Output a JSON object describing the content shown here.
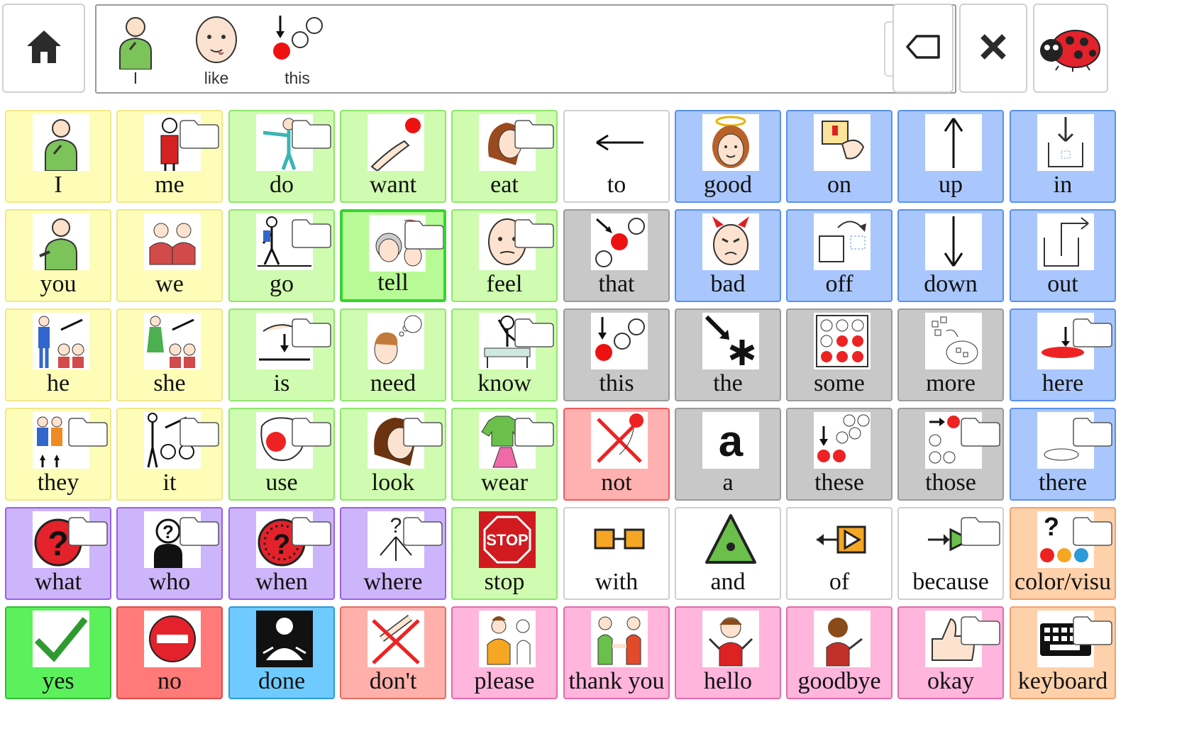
{
  "toolbar": {
    "home_label": "",
    "sentence_words": [
      {
        "label": "I",
        "icon": "person-pointing-self-icon"
      },
      {
        "label": "like",
        "icon": "face-licking-icon"
      },
      {
        "label": "this",
        "icon": "this-arrow-circles-icon"
      }
    ],
    "dropdown_icon": "chevron-down-icon",
    "backspace_icon": "backspace-icon",
    "clear_icon": "close-icon",
    "mascot_icon": "ladybug-icon"
  },
  "grid": {
    "cells": [
      {
        "label": "I",
        "color": "y",
        "icon": "person-pointing-self-icon",
        "folder": false
      },
      {
        "label": "me",
        "color": "y",
        "icon": "person-me-icon",
        "folder": true
      },
      {
        "label": "do",
        "color": "g",
        "icon": "person-doing-icon",
        "folder": true
      },
      {
        "label": "want",
        "color": "g",
        "icon": "hand-reaching-icon",
        "folder": false
      },
      {
        "label": "eat",
        "color": "g",
        "icon": "person-eating-icon",
        "folder": true
      },
      {
        "label": "to",
        "color": "w",
        "icon": "arrow-left-icon",
        "folder": false
      },
      {
        "label": "good",
        "color": "b",
        "icon": "angel-face-icon",
        "folder": false
      },
      {
        "label": "on",
        "color": "b",
        "icon": "switch-on-icon",
        "folder": false
      },
      {
        "label": "up",
        "color": "b",
        "icon": "arrow-up-icon",
        "folder": false
      },
      {
        "label": "in",
        "color": "b",
        "icon": "arrow-into-box-icon",
        "folder": false
      },
      {
        "label": "you",
        "color": "y",
        "icon": "person-pointing-you-icon",
        "folder": false
      },
      {
        "label": "we",
        "color": "y",
        "icon": "two-people-icon",
        "folder": false
      },
      {
        "label": "go",
        "color": "g",
        "icon": "people-walking-icon",
        "folder": true
      },
      {
        "label": "tell",
        "color": "sel",
        "icon": "people-talking-icon",
        "folder": true
      },
      {
        "label": "feel",
        "color": "g",
        "icon": "face-feeling-icon",
        "folder": true
      },
      {
        "label": "that",
        "color": "gr",
        "icon": "that-arrow-circles-icon",
        "folder": false
      },
      {
        "label": "bad",
        "color": "b",
        "icon": "devil-face-icon",
        "folder": false
      },
      {
        "label": "off",
        "color": "b",
        "icon": "box-off-icon",
        "folder": false
      },
      {
        "label": "down",
        "color": "b",
        "icon": "arrow-down-icon",
        "folder": false
      },
      {
        "label": "out",
        "color": "b",
        "icon": "arrow-out-box-icon",
        "folder": false
      },
      {
        "label": "he",
        "color": "y",
        "icon": "man-pointed-icon",
        "folder": false
      },
      {
        "label": "she",
        "color": "y",
        "icon": "woman-pointed-icon",
        "folder": false
      },
      {
        "label": "is",
        "color": "g",
        "icon": "hand-is-icon",
        "folder": true
      },
      {
        "label": "need",
        "color": "g",
        "icon": "person-thinking-icon",
        "folder": false
      },
      {
        "label": "know",
        "color": "g",
        "icon": "teacher-icon",
        "folder": true
      },
      {
        "label": "this",
        "color": "gr",
        "icon": "this-arrow-circles-icon",
        "folder": false
      },
      {
        "label": "the",
        "color": "gr",
        "icon": "asterisk-arrow-icon",
        "folder": false
      },
      {
        "label": "some",
        "color": "gr",
        "icon": "circles-some-icon",
        "folder": false
      },
      {
        "label": "more",
        "color": "gr",
        "icon": "more-squares-icon",
        "folder": false
      },
      {
        "label": "here",
        "color": "b",
        "icon": "here-spot-icon",
        "folder": true
      },
      {
        "label": "they",
        "color": "y",
        "icon": "group-people-icon",
        "folder": true
      },
      {
        "label": "it",
        "color": "y",
        "icon": "person-it-icon",
        "folder": true
      },
      {
        "label": "use",
        "color": "g",
        "icon": "hand-using-icon",
        "folder": true
      },
      {
        "label": "look",
        "color": "g",
        "icon": "head-looking-icon",
        "folder": true
      },
      {
        "label": "wear",
        "color": "g",
        "icon": "clothes-icon",
        "folder": true
      },
      {
        "label": "not",
        "color": "r",
        "icon": "cross-not-icon",
        "folder": false
      },
      {
        "label": "a",
        "color": "gr",
        "icon": "letter-a-icon",
        "folder": false
      },
      {
        "label": "these",
        "color": "gr",
        "icon": "these-circles-icon",
        "folder": false
      },
      {
        "label": "those",
        "color": "gr",
        "icon": "those-circles-icon",
        "folder": true
      },
      {
        "label": "there",
        "color": "b",
        "icon": "there-ellipse-icon",
        "folder": true
      },
      {
        "label": "what",
        "color": "p",
        "icon": "question-red-icon",
        "folder": true
      },
      {
        "label": "who",
        "color": "p",
        "icon": "question-person-icon",
        "folder": true
      },
      {
        "label": "when",
        "color": "p",
        "icon": "question-clock-icon",
        "folder": true
      },
      {
        "label": "where",
        "color": "p",
        "icon": "question-arrows-icon",
        "folder": true
      },
      {
        "label": "stop",
        "color": "g",
        "icon": "stop-sign-icon",
        "folder": false
      },
      {
        "label": "with",
        "color": "w",
        "icon": "two-boxes-linked-icon",
        "folder": false
      },
      {
        "label": "and",
        "color": "w",
        "icon": "triangle-dot-icon",
        "folder": false
      },
      {
        "label": "of",
        "color": "w",
        "icon": "arrow-triangle-box-icon",
        "folder": false
      },
      {
        "label": "because",
        "color": "w",
        "icon": "because-icon",
        "folder": true
      },
      {
        "label": "color/visu",
        "color": "o",
        "icon": "color-dots-icon",
        "folder": true
      },
      {
        "label": "yes",
        "color": "gg",
        "icon": "check-icon",
        "folder": false
      },
      {
        "label": "no",
        "color": "rr",
        "icon": "no-entry-icon",
        "folder": false
      },
      {
        "label": "done",
        "color": "bb",
        "icon": "done-person-icon",
        "folder": false
      },
      {
        "label": "don't",
        "color": "rp",
        "icon": "dont-cross-icon",
        "folder": false
      },
      {
        "label": "please",
        "color": "pk",
        "icon": "please-people-icon",
        "folder": false
      },
      {
        "label": "thank you",
        "color": "pk",
        "icon": "handshake-icon",
        "folder": false
      },
      {
        "label": "hello",
        "color": "pk",
        "icon": "waving-girl-icon",
        "folder": false
      },
      {
        "label": "goodbye",
        "color": "pk",
        "icon": "waving-bye-icon",
        "folder": false
      },
      {
        "label": "okay",
        "color": "pk",
        "icon": "thumbs-up-icon",
        "folder": true
      },
      {
        "label": "keyboard",
        "color": "o",
        "icon": "keyboard-icon",
        "folder": true
      }
    ]
  }
}
